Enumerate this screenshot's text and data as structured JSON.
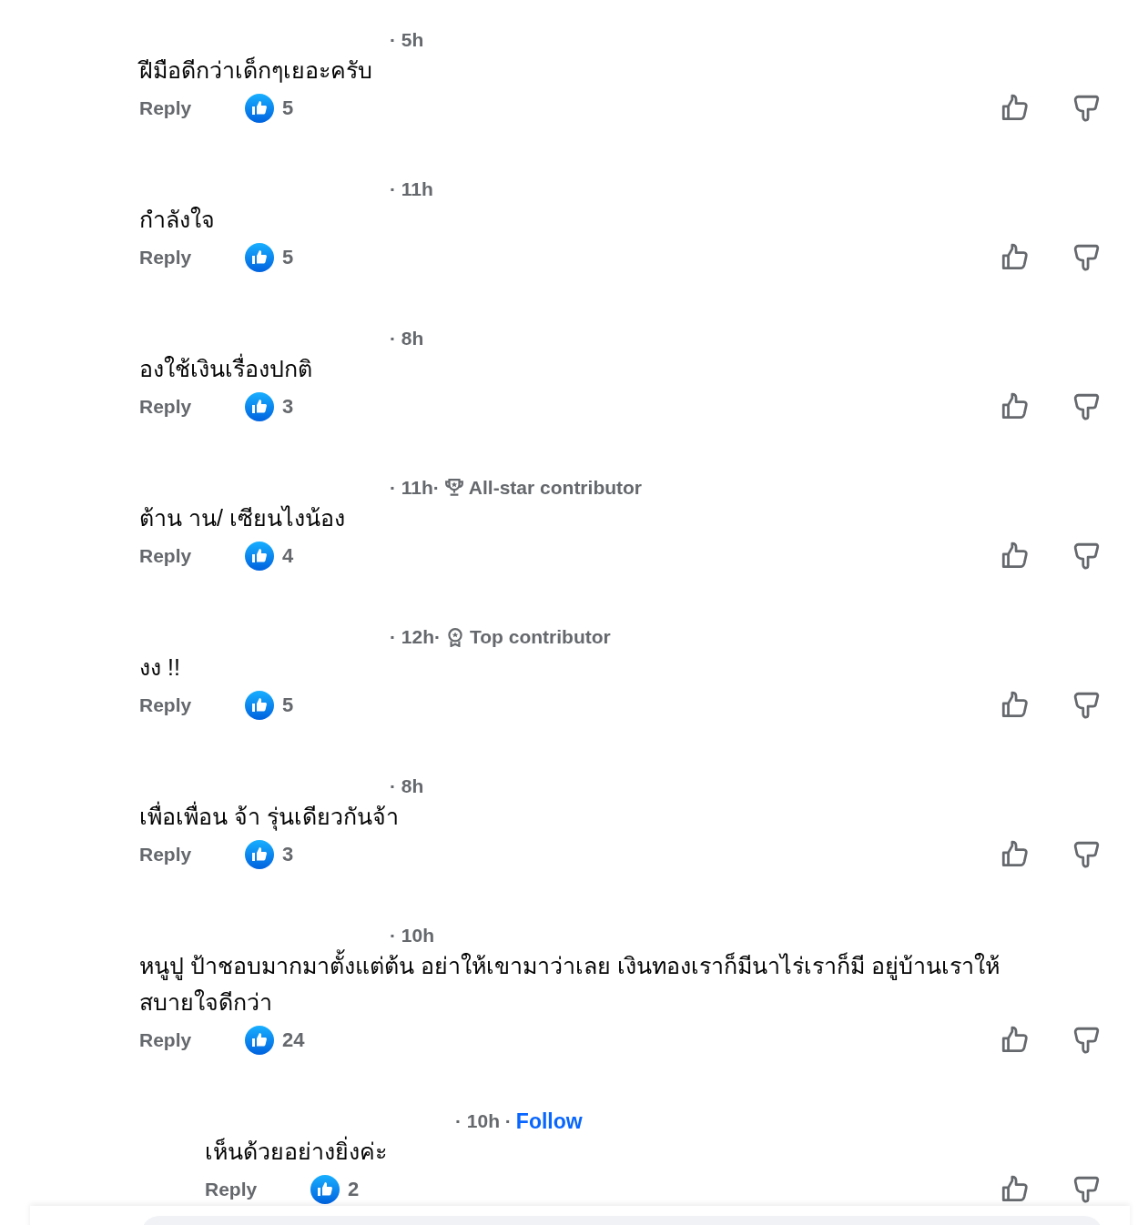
{
  "comments": [
    {
      "time": "· 5h",
      "text": "ฝีมือดีกว่าเด็กๆเยอะครับ",
      "reply": "Reply",
      "likes": "5"
    },
    {
      "time": "· 11h",
      "text": "กำลังใจ",
      "reply": "Reply",
      "likes": "5"
    },
    {
      "time": "· 8h",
      "text": "องใช้เงินเรื่องปกติ",
      "reply": "Reply",
      "likes": "3"
    },
    {
      "time": "· 11h·",
      "badge": {
        "kind": "trophy",
        "label": "All-star contributor"
      },
      "text": "ต้าน าน/ เซียนไงน้อง",
      "reply": "Reply",
      "likes": "4"
    },
    {
      "time": "· 12h·",
      "badge": {
        "kind": "ribbon",
        "label": "Top contributor"
      },
      "text": "งง !!",
      "reply": "Reply",
      "likes": "5"
    },
    {
      "time": "· 8h",
      "text": "เพื่อเพื่อน จ้า รุ่นเดียวกันจ้า",
      "reply": "Reply",
      "likes": "3"
    },
    {
      "time": "· 10h",
      "text": "หนูปู ป้าชอบมากมาตั้งแต่ต้น อย่าให้เขามาว่าเลย เงินทองเราก็มีนาไร่เราก็มี อยู่บ้านเราให้สบายใจดีกว่า",
      "reply": "Reply",
      "likes": "24",
      "children": [
        {
          "time": "· 10h ·",
          "follow": "Follow",
          "text": "เห็นด้วยอย่างยิ่งค่ะ",
          "reply": "Reply",
          "likes": "2"
        }
      ]
    }
  ]
}
